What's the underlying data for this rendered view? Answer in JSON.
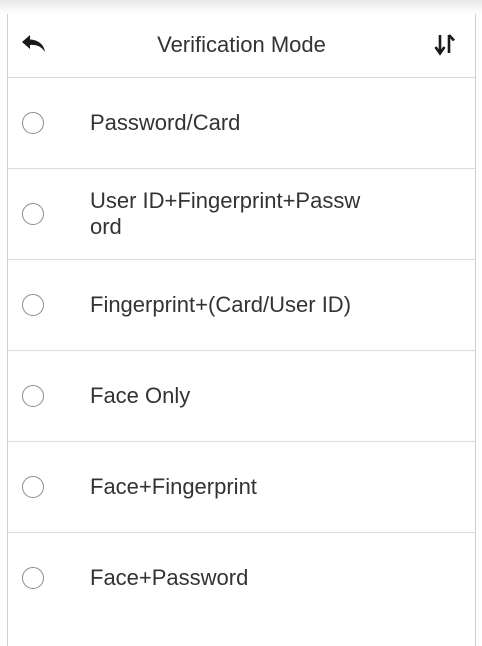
{
  "header": {
    "title": "Verification Mode",
    "back_icon": "back-arrow-icon",
    "sort_icon": "sort-icon"
  },
  "options": [
    {
      "label": "Password/Card",
      "selected": false
    },
    {
      "label": "User ID+Fingerprint+Passw\nord",
      "selected": false
    },
    {
      "label": "Fingerprint+(Card/User ID)",
      "selected": false
    },
    {
      "label": "Face Only",
      "selected": false
    },
    {
      "label": "Face+Fingerprint",
      "selected": false
    },
    {
      "label": "Face+Password",
      "selected": false
    }
  ],
  "colors": {
    "text": "#333333",
    "divider": "#dcdcdc",
    "radio_border": "#8c8c8c",
    "icon": "#1a1a1a"
  }
}
